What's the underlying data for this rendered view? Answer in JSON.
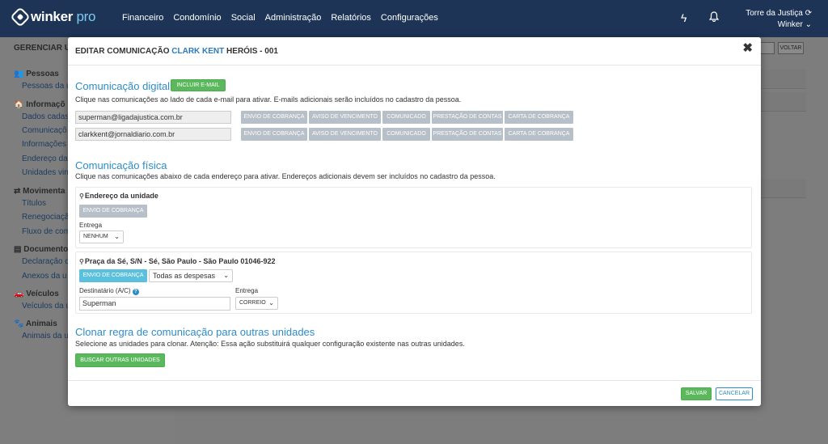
{
  "navbar": {
    "logo_text": "winker",
    "logo_suffix": "pro",
    "menu": [
      "Financeiro",
      "Condomínio",
      "Social",
      "Administração",
      "Relatórios",
      "Configurações"
    ],
    "user_name": "Torre da Justiça",
    "user_sub": "Winker"
  },
  "background": {
    "title": "GERENCIAR U",
    "voltar": "VOLTAR",
    "sections": [
      {
        "label": "Pessoas",
        "links": [
          "Pessoas da u"
        ]
      },
      {
        "label": "Informaçõ",
        "links": [
          "Dados cadas",
          "Comunicaçõ",
          "Informações",
          "Endereço da",
          "Unidades vin"
        ]
      },
      {
        "label": "Movimenta",
        "links": [
          "Títulos",
          "Renegociaçã",
          "Fluxo de com"
        ]
      },
      {
        "label": "Documento",
        "links": [
          "Declaração q",
          "Anexos da u"
        ]
      },
      {
        "label": "Veículos",
        "links": [
          "Veículos da u"
        ]
      },
      {
        "label": "Animais",
        "links": [
          "Animais da u"
        ]
      }
    ]
  },
  "modal": {
    "title_prefix": "EDITAR COMUNICAÇÃO",
    "title_name": "CLARK KENT",
    "title_suffix": "HERÓIS - 001",
    "digital": {
      "heading": "Comunicação digital",
      "add_email_button": "INCLUIR E-MAIL",
      "description": "Clique nas comunicações ao lado de cada e-mail para ativar. E-mails adicionais serão incluídos no cadastro da pessoa.",
      "emails": [
        {
          "address": "superman@ligadajustica.com.br",
          "tags": [
            "ENVIO DE COBRANÇA",
            "AVISO DE VENCIMENTO",
            "COMUNICADO",
            "PRESTAÇÃO DE CONTAS",
            "CARTA DE COBRANÇA"
          ]
        },
        {
          "address": "clarkkent@jornaldiario.com.br",
          "tags": [
            "ENVIO DE COBRANÇA",
            "AVISO DE VENCIMENTO",
            "COMUNICADO",
            "PRESTAÇÃO DE CONTAS",
            "CARTA DE COBRANÇA"
          ]
        }
      ]
    },
    "physical": {
      "heading": "Comunicação física",
      "description": "Clique nas comunicações abaixo de cada endereço para ativar. Endereços adicionais devem ser incluídos no cadastro da pessoa.",
      "unit_address": {
        "title": "Endereço da unidade",
        "tag": "ENVIO DE COBRANÇA",
        "delivery_label": "Entrega",
        "delivery_value": "NENHUM"
      },
      "other_address": {
        "title": "Praça da Sé, S/N - Sé, São Paulo - São Paulo 01046-922",
        "tag": "ENVIO DE COBRANÇA",
        "expense_value": "Todas as despesas",
        "recipient_label": "Destinatário (A/C)",
        "recipient_value": "Superman",
        "delivery_label": "Entrega",
        "delivery_value": "CORREIO"
      }
    },
    "clone": {
      "heading": "Clonar regra de comunicação para outras unidades",
      "description": "Selecione as unidades para clonar. Atenção: Essa ação substituirá qualquer configuração existente nas outras unidades.",
      "search_button": "BUSCAR OUTRAS UNIDADES"
    },
    "footer": {
      "save": "SALVAR",
      "cancel": "CANCELAR"
    }
  },
  "colors": {
    "navbar": "#1e3456",
    "accent": "#2e8cc8",
    "green": "#5cb85c",
    "tag_inactive": "#b7bfc8",
    "tag_active": "#5bc0de"
  }
}
